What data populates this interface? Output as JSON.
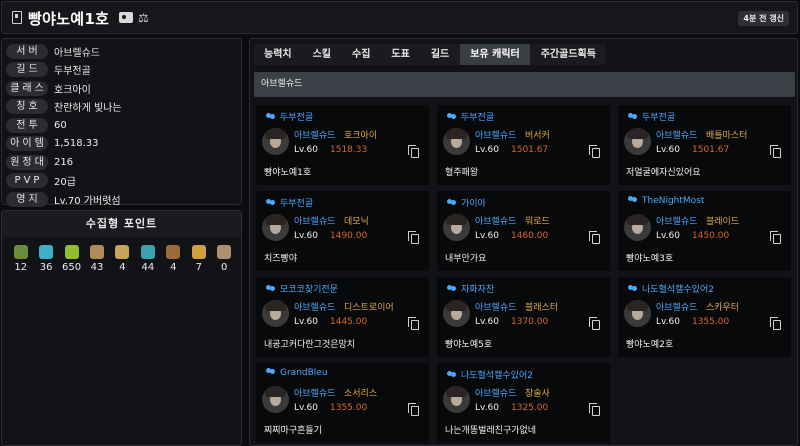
{
  "header": {
    "title": "빵야노예1호",
    "refresh_label": "4분 전 갱신"
  },
  "info": [
    {
      "key": "서버",
      "value": "아브렐슈드"
    },
    {
      "key": "길드",
      "value": "두부전골"
    },
    {
      "key": "클래스",
      "value": "호크아이"
    },
    {
      "key": "칭호",
      "value": "찬란하게 빛나는"
    },
    {
      "key": "전투",
      "value": "60"
    },
    {
      "key": "아이템",
      "value": "1,518.33"
    },
    {
      "key": "원정대",
      "value": "216"
    },
    {
      "key": "PVP",
      "value": "20급"
    },
    {
      "key": "영지",
      "value": "Lv.70 가버렷섬"
    }
  ],
  "collection": {
    "title": "수집형 포인트",
    "items": [
      {
        "icon": "mokoko-seed-icon",
        "value": "12",
        "color": "#6b8a3a"
      },
      {
        "icon": "island-heart-icon",
        "value": "36",
        "color": "#3fb0c8"
      },
      {
        "icon": "giant-heart-icon",
        "value": "650",
        "color": "#8fbf2f"
      },
      {
        "icon": "art-icon",
        "value": "43",
        "color": "#b08a5a"
      },
      {
        "icon": "voyage-icon",
        "value": "4",
        "color": "#c8a45a"
      },
      {
        "icon": "world-tree-leaf-icon",
        "value": "44",
        "color": "#3fa0b0"
      },
      {
        "icon": "ignea-token-icon",
        "value": "4",
        "color": "#9b6b3a"
      },
      {
        "icon": "orpheus-star-icon",
        "value": "7",
        "color": "#d0a040"
      },
      {
        "icon": "orb-icon",
        "value": "0",
        "color": "#b09070"
      }
    ]
  },
  "tabs": [
    {
      "label": "능력치",
      "active": false
    },
    {
      "label": "스킬",
      "active": false
    },
    {
      "label": "수집",
      "active": false
    },
    {
      "label": "도표",
      "active": false
    },
    {
      "label": "길드",
      "active": false
    },
    {
      "label": "보유 캐릭터",
      "active": true
    },
    {
      "label": "주간골드획득",
      "active": false
    }
  ],
  "server_group": "아브렐슈드",
  "characters": [
    {
      "guild": "두부전골",
      "server": "아브렐슈드",
      "class": "호크아이",
      "level": "Lv.60",
      "item_level": "1518.33",
      "name": "빵야노예1호"
    },
    {
      "guild": "두부전골",
      "server": "아브렐슈드",
      "class": "버서커",
      "level": "Lv.60",
      "item_level": "1501.67",
      "name": "혈주패왕"
    },
    {
      "guild": "두부전골",
      "server": "아브렐슈드",
      "class": "배틀마스터",
      "level": "Lv.60",
      "item_level": "1501.67",
      "name": "저얼굴에자신있어요"
    },
    {
      "guild": "두부전골",
      "server": "아브렐슈드",
      "class": "데모닉",
      "level": "Lv.60",
      "item_level": "1490.00",
      "name": "치즈빵야"
    },
    {
      "guild": "가이아",
      "server": "아브렐슈드",
      "class": "워로드",
      "level": "Lv.60",
      "item_level": "1460.00",
      "name": "내부안가요"
    },
    {
      "guild": "TheNightMost",
      "server": "아브렐슈드",
      "class": "블레이드",
      "level": "Lv.60",
      "item_level": "1450.00",
      "name": "빵야노예3호"
    },
    {
      "guild": "모코코찾기전문",
      "server": "아브렐슈드",
      "class": "디스트로이어",
      "level": "Lv.60",
      "item_level": "1445.00",
      "name": "내공고커다란그것은망치"
    },
    {
      "guild": "자화자찬",
      "server": "아브렐슈드",
      "class": "블래스터",
      "level": "Lv.60",
      "item_level": "1370.00",
      "name": "빵야노예5호"
    },
    {
      "guild": "나도혈석캘수있어2",
      "server": "아브렐슈드",
      "class": "스카우터",
      "level": "Lv.60",
      "item_level": "1355.00",
      "name": "빵야노예2호"
    },
    {
      "guild": "GrandBleu",
      "server": "아브렐슈드",
      "class": "소서리스",
      "level": "Lv.60",
      "item_level": "1355.00",
      "name": "찌찌마구흔들기"
    },
    {
      "guild": "나도혈석캘수있어2",
      "server": "아브렐슈드",
      "class": "창술사",
      "level": "Lv.60",
      "item_level": "1325.00",
      "name": "나는개똥벌레친구가없네"
    }
  ]
}
